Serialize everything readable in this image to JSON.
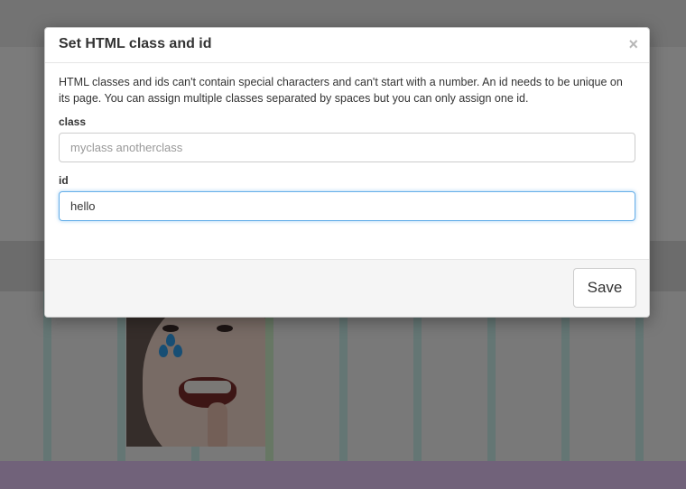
{
  "modal": {
    "title": "Set HTML class and id",
    "close_symbol": "×",
    "help_text": "HTML classes and ids can't contain special characters and can't start with a number. An id needs to be unique on its page. You can assign multiple classes separated by spaces but you can only assign one id.",
    "class_field": {
      "label": "class",
      "value": "",
      "placeholder": "myclass anotherclass"
    },
    "id_field": {
      "label": "id",
      "value": "hello",
      "placeholder": ""
    },
    "save_label": "Save"
  },
  "colors": {
    "overlay": "rgba(0,0,0,0.5)",
    "focus_border": "#66afe9",
    "bottom_bar": "#e3c4f4",
    "column_lines": "#c8ece8"
  },
  "icons": {
    "close": "close-icon"
  }
}
